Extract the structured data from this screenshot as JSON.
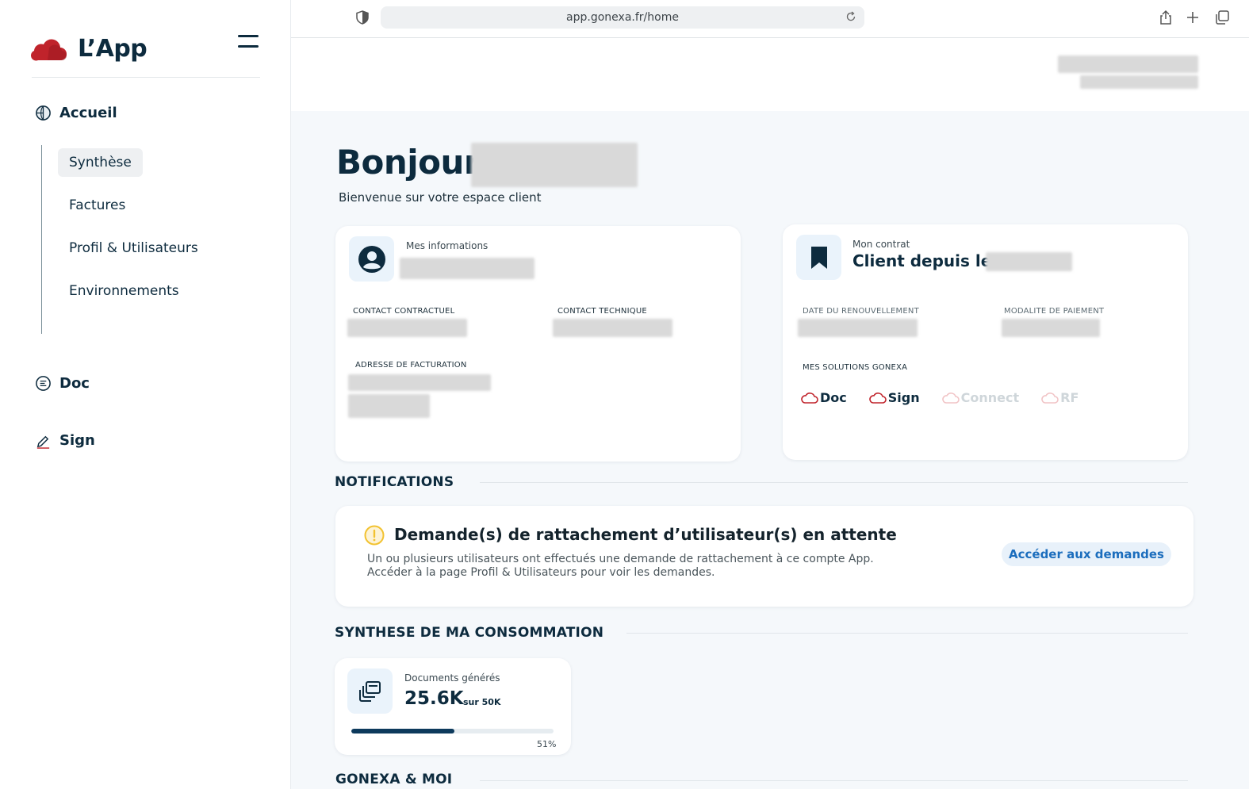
{
  "browser": {
    "url": "app.gonexa.fr/home"
  },
  "sidebar": {
    "app_name": "L’App",
    "sections": [
      {
        "label": "Accueil"
      },
      {
        "label": "Doc"
      },
      {
        "label": "Sign"
      }
    ],
    "subnav": [
      {
        "label": "Synthèse",
        "active": true
      },
      {
        "label": "Factures",
        "active": false
      },
      {
        "label": "Profil & Utilisateurs",
        "active": false
      },
      {
        "label": "Environnements",
        "active": false
      }
    ]
  },
  "main": {
    "greeting": "Bonjour",
    "welcome": "Bienvenue sur votre espace client",
    "info_card": {
      "label": "Mes informations",
      "contact_contractuel": "CONTACT CONTRACTUEL",
      "contact_technique": "CONTACT TECHNIQUE",
      "adresse": "ADRESSE DE FACTURATION"
    },
    "contract_card": {
      "label": "Mon contrat",
      "title": "Client depuis le",
      "renewal": "DATE DU RENOUVELLEMENT",
      "payment": "MODALITE DE PAIEMENT",
      "solutions_label": "MES SOLUTIONS GONEXA",
      "solutions": [
        {
          "label": "Doc",
          "active": true
        },
        {
          "label": "Sign",
          "active": true
        },
        {
          "label": "Connect",
          "active": false
        },
        {
          "label": "RF",
          "active": false
        }
      ]
    },
    "notifications": {
      "title": "NOTIFICATIONS",
      "item_title": "Demande(s) de rattachement d’utilisateur(s) en attente",
      "line1": "Un ou plusieurs utilisateurs ont effectués une demande de rattachement à ce compte App.",
      "line2": "Accéder à la page Profil & Utilisateurs pour voir les demandes.",
      "button": "Accéder aux demandes"
    },
    "consumption": {
      "title": "SYNTHESE DE MA CONSOMMATION",
      "label": "Documents générés",
      "value": "25.6K",
      "total": "sur 50K",
      "progress_fraction": 0.51,
      "percent": "51%"
    },
    "gonexa_moi": {
      "title": "GONEXA & MOI"
    }
  },
  "colors": {
    "brand_red": "#c0232b",
    "navy": "#0d2b3e",
    "accent_blue": "#1b6dbd",
    "warning": "#f2c230"
  }
}
